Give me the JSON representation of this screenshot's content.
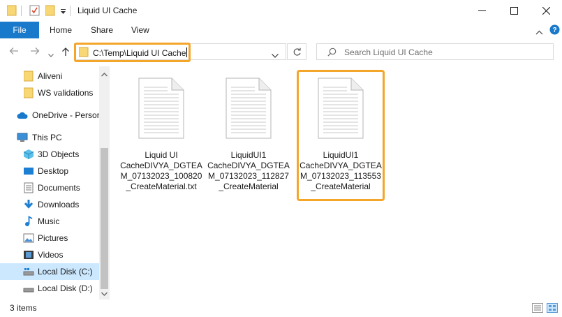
{
  "window": {
    "title": "Liquid UI Cache",
    "minimize_icon": "minimize-icon",
    "maximize_icon": "maximize-icon",
    "close_icon": "close-icon"
  },
  "ribbon": {
    "tabs": [
      {
        "label": "File"
      },
      {
        "label": "Home"
      },
      {
        "label": "Share"
      },
      {
        "label": "View"
      }
    ]
  },
  "navigation": {
    "address": "C:\\Temp\\Liquid UI Cache",
    "search_placeholder": "Search Liquid UI Cache"
  },
  "sidebar": {
    "items": [
      {
        "label": "Aliveni",
        "icon": "folder-icon"
      },
      {
        "label": "WS validations",
        "icon": "folder-icon"
      },
      {
        "label": "OneDrive - Persor",
        "icon": "cloud-icon"
      },
      {
        "label": "This PC",
        "icon": "computer-icon"
      },
      {
        "label": "3D Objects",
        "icon": "cube-icon"
      },
      {
        "label": "Desktop",
        "icon": "desktop-icon"
      },
      {
        "label": "Documents",
        "icon": "documents-icon"
      },
      {
        "label": "Downloads",
        "icon": "download-arrow-icon"
      },
      {
        "label": "Music",
        "icon": "music-note-icon"
      },
      {
        "label": "Pictures",
        "icon": "pictures-icon"
      },
      {
        "label": "Videos",
        "icon": "film-icon"
      },
      {
        "label": "Local Disk (C:)",
        "icon": "drive-icon"
      },
      {
        "label": "Local Disk (D:)",
        "icon": "drive-icon"
      }
    ]
  },
  "files": [
    {
      "lines": [
        "Liquid UI",
        "CacheDIVYA_DGTEA",
        "M_07132023_100820",
        "_CreateMaterial.txt"
      ]
    },
    {
      "lines": [
        "LiquidUI1",
        "CacheDIVYA_DGTEA",
        "M_07132023_112827",
        "_CreateMaterial"
      ]
    },
    {
      "lines": [
        "LiquidUI1",
        "CacheDIVYA_DGTEA",
        "M_07132023_113553",
        "_CreateMaterial"
      ]
    }
  ],
  "status": {
    "item_count": "3 items"
  },
  "colors": {
    "accent": "#1979ca",
    "highlight": "#f4a62a",
    "folder": "#f8d775",
    "selection": "#cce8ff"
  }
}
